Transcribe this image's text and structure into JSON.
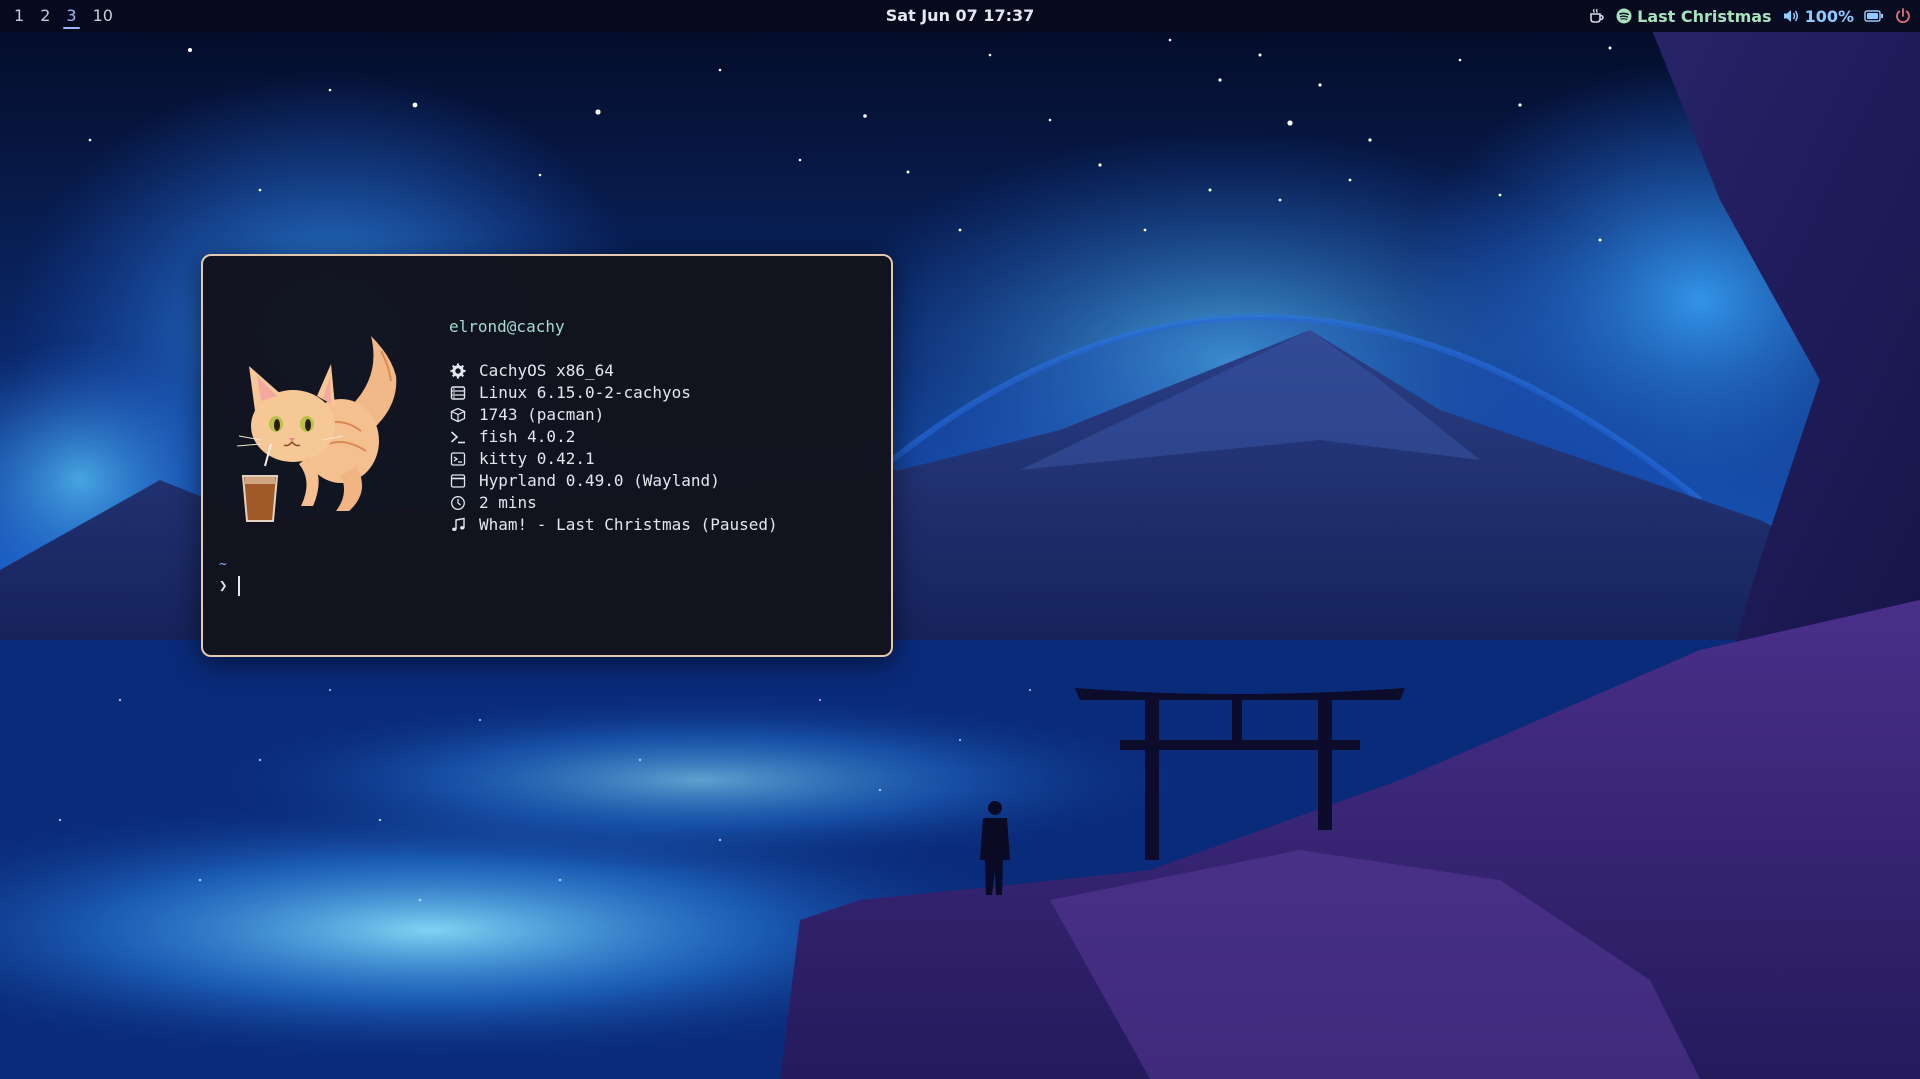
{
  "topbar": {
    "workspaces": [
      {
        "label": "1",
        "active": false
      },
      {
        "label": "2",
        "active": false
      },
      {
        "label": "3",
        "active": true
      },
      {
        "label": "10",
        "active": false
      }
    ],
    "clock": "Sat Jun 07 17:37",
    "tray": {
      "idle_inhibitor_icon": "coffee-cup-icon",
      "media_icon": "spotify-icon",
      "media_title": "Last Christmas",
      "volume_icon": "speaker-icon",
      "volume_level": "100%",
      "battery_icon": "battery-icon",
      "power_icon": "power-icon"
    },
    "colors": {
      "background": "#080a1c",
      "text": "#d8dbe8",
      "active_workspace": "#9fb4ff",
      "media": "#a6e3bd",
      "volume": "#8ecbff"
    }
  },
  "terminal": {
    "border_color": "#e3c8ae",
    "logo_icon": "cat-drinking-tea-logo",
    "userhost": "elrond@cachy",
    "info": [
      {
        "icon": "gear-icon",
        "value": "CachyOS x86_64"
      },
      {
        "icon": "kernel-icon",
        "value": "Linux 6.15.0-2-cachyos"
      },
      {
        "icon": "package-icon",
        "value": "1743 (pacman)"
      },
      {
        "icon": "shell-prompt-icon",
        "value": "fish 4.0.2"
      },
      {
        "icon": "terminal-icon",
        "value": "kitty 0.42.1"
      },
      {
        "icon": "window-icon",
        "value": "Hyprland 0.49.0 (Wayland)"
      },
      {
        "icon": "clock-icon",
        "value": "2 mins"
      },
      {
        "icon": "music-note-icon",
        "value": "Wham! - Last Christmas (Paused)"
      }
    ],
    "prompt": {
      "directory": "~",
      "symbol": "❯",
      "input": ""
    }
  }
}
